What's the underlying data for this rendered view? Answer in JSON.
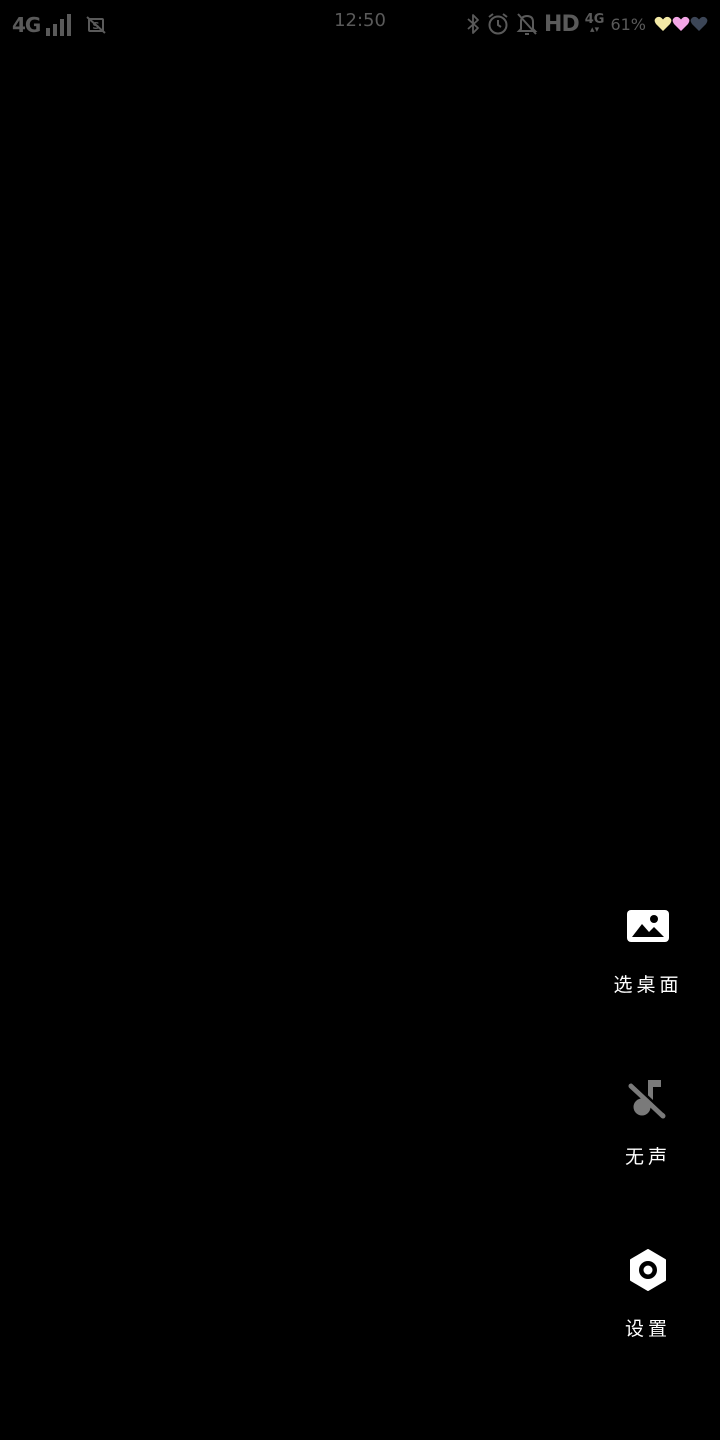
{
  "status_bar": {
    "network_left": "4G",
    "time": "12:50",
    "hd": "HD",
    "network_right": "4G",
    "battery": "61%",
    "icons": [
      "signal-icon",
      "screenshot-app-icon",
      "bluetooth-icon",
      "alarm-icon",
      "notifications-off-icon",
      "heart-icons"
    ]
  },
  "menu": {
    "wallpaper": {
      "label": "选桌面",
      "icon": "image-icon"
    },
    "sound": {
      "label": "无声",
      "icon": "music-off-icon"
    },
    "settings": {
      "label": "设置",
      "icon": "settings-hex-icon"
    }
  },
  "colors": {
    "background": "#000000",
    "status_text": "#5a5a5a",
    "menu_icon": "#ffffff",
    "menu_icon_disabled": "#7a7a7a"
  }
}
